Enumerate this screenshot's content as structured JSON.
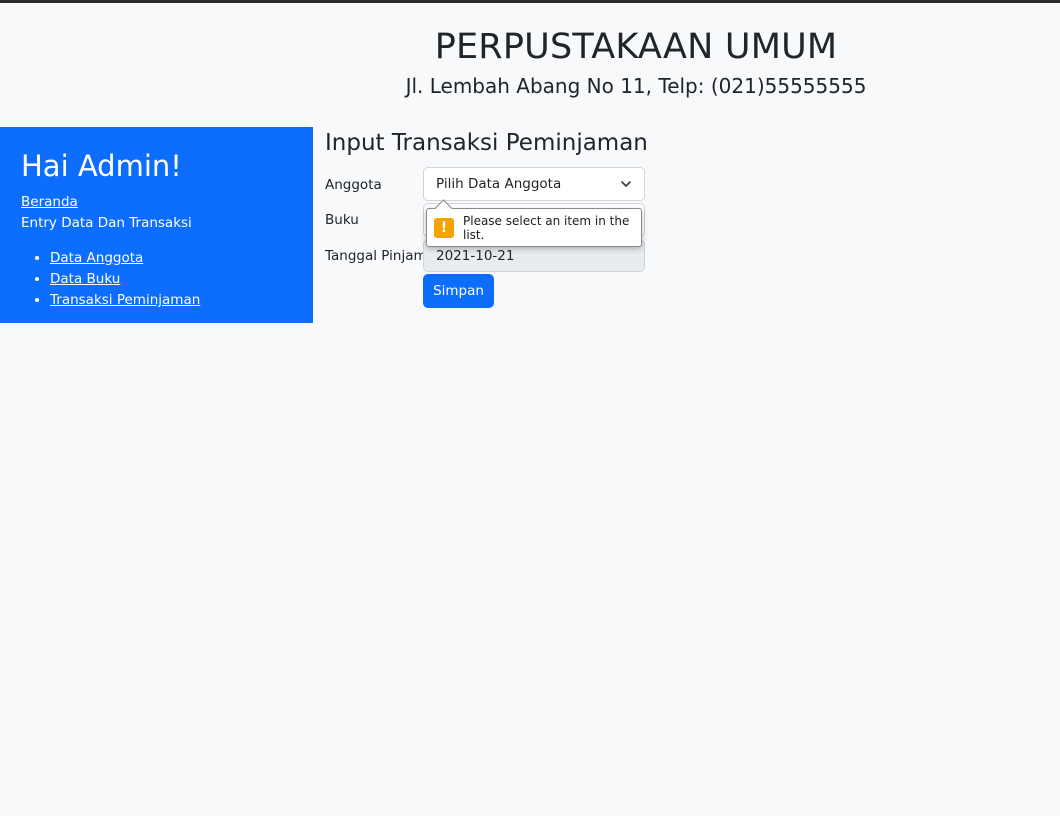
{
  "header": {
    "title": "PERPUSTAKAAN UMUM",
    "subtitle": "Jl. Lembah Abang No 11, Telp: (021)55555555"
  },
  "sidebar": {
    "greeting": "Hai Admin!",
    "home_link": "Beranda",
    "section_title": "Entry Data Dan Transaksi",
    "items": [
      {
        "label": "Data Anggota"
      },
      {
        "label": "Data Buku"
      },
      {
        "label": "Transaksi Peminjaman"
      }
    ]
  },
  "form": {
    "title": "Input Transaksi Peminjaman",
    "member_label": "Anggota",
    "member_value": "Pilih Data Anggota",
    "book_label": "Buku",
    "book_value": "",
    "date_label": "Tanggal Pinjam",
    "date_value": "2021-10-21",
    "submit_label": "Simpan"
  },
  "validation": {
    "message": "Please select an item in the list.",
    "icon": "warning-icon",
    "icon_color": "#f5a300"
  },
  "colors": {
    "primary": "#0d6efd",
    "background": "#f8f9fa",
    "text": "#212529"
  }
}
